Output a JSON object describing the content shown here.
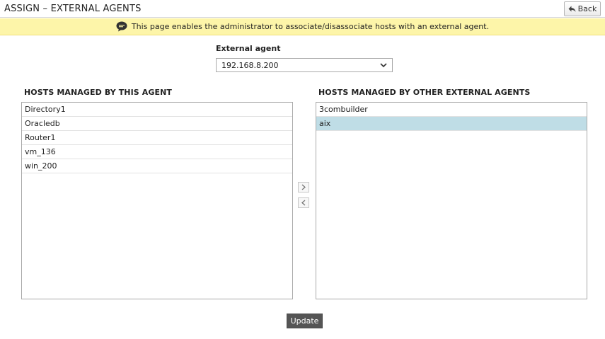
{
  "header": {
    "title": "ASSIGN – EXTERNAL AGENTS",
    "back_label": "Back"
  },
  "info_bar": {
    "message": "This page enables the administrator to associate/disassociate hosts with an external agent."
  },
  "agent": {
    "label": "External agent",
    "selected": "192.168.8.200"
  },
  "managed_hosts": {
    "heading": "HOSTS MANAGED BY THIS AGENT",
    "items": [
      "Directory1",
      "Oracledb",
      "Router1",
      "vm_136",
      "win_200"
    ]
  },
  "other_hosts": {
    "heading": "HOSTS MANAGED BY OTHER EXTERNAL AGENTS",
    "items": [
      "3combuilder",
      "aix"
    ],
    "selected_item": "aix"
  },
  "actions": {
    "update_label": "Update"
  },
  "colors": {
    "info_bar_bg": "#fdf5a9",
    "selected_row_bg": "#bfdde6",
    "update_button_bg": "#555555"
  }
}
